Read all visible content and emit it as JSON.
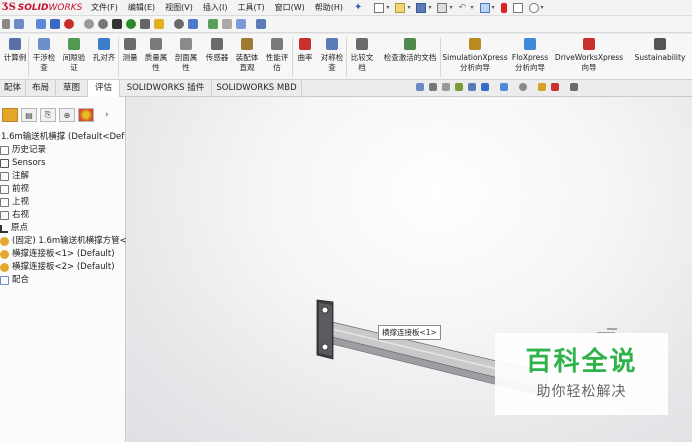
{
  "app": {
    "logo_ds": "ƷS",
    "logo_solid": "SOLID",
    "logo_works": "WORKS"
  },
  "menu": [
    "文件(F)",
    "编辑(E)",
    "视图(V)",
    "插入(I)",
    "工具(T)",
    "窗口(W)",
    "帮助(H)"
  ],
  "ribbon": {
    "buttons": [
      {
        "label": "计算例",
        "label2": "",
        "color": "#5a6fa8"
      },
      {
        "label": "干涉检",
        "label2": "查",
        "color": "#6b8fc9"
      },
      {
        "label": "间隙验",
        "label2": "证",
        "color": "#4f9a4f"
      },
      {
        "label": "孔对齐",
        "label2": "",
        "color": "#3d7cc9"
      },
      {
        "label": "测量",
        "label2": "",
        "color": "#6a6a6a"
      },
      {
        "label": "质量属",
        "label2": "性",
        "color": "#7a7a7a"
      },
      {
        "label": "剖面属",
        "label2": "性",
        "color": "#8a8a8a"
      },
      {
        "label": "传感器",
        "label2": "",
        "color": "#6a6a6a"
      },
      {
        "label": "装配体",
        "label2": "直观",
        "color": "#a07a30"
      },
      {
        "label": "性能评",
        "label2": "估",
        "color": "#7a7a7a"
      },
      {
        "label": "曲率",
        "label2": "",
        "color": "#c8302e"
      },
      {
        "label": "对称检",
        "label2": "查",
        "color": "#5a7ab8"
      },
      {
        "label": "比较文",
        "label2": "档",
        "color": "#6a6a6a"
      },
      {
        "label": "检查激活的文档",
        "label2": "",
        "color": "#4f8a4f"
      },
      {
        "label": "SimulationXpress",
        "label2": "分析向导",
        "color": "#b88a20"
      },
      {
        "label": "FloXpress",
        "label2": "分析向导",
        "color": "#3a8ad8"
      },
      {
        "label": "DriveWorksXpress",
        "label2": "向导",
        "color": "#c8302e"
      },
      {
        "label": "Sustainability",
        "label2": "",
        "color": "#555555"
      }
    ]
  },
  "tabs": [
    "配体",
    "布局",
    "草图",
    "评估",
    "SOLIDWORKS 插件",
    "SOLIDWORKS MBD"
  ],
  "active_tab": "评估",
  "tree": {
    "root": "1.6m输送机横撑 (Default<Def",
    "items": [
      {
        "label": "历史记录",
        "icon": "history-icon"
      },
      {
        "label": "Sensors",
        "icon": "sensors-icon"
      },
      {
        "label": "注解",
        "icon": "annotations-icon"
      },
      {
        "label": "前视",
        "icon": "plane-icon"
      },
      {
        "label": "上视",
        "icon": "plane-icon"
      },
      {
        "label": "右视",
        "icon": "plane-icon"
      },
      {
        "label": "原点",
        "icon": "origin-icon"
      },
      {
        "label": "(固定) 1.6m输送机横撑方管<",
        "icon": "part-icon"
      },
      {
        "label": "横撑连接板<1> (Default)",
        "icon": "part-icon"
      },
      {
        "label": "横撑连接板<2> (Default)",
        "icon": "part-icon"
      },
      {
        "label": "配合",
        "icon": "mates-icon"
      }
    ]
  },
  "viewport": {
    "tooltip": "横撑连接板<1>"
  },
  "watermark": {
    "title": "百科全说",
    "subtitle": "助你轻松解决"
  }
}
